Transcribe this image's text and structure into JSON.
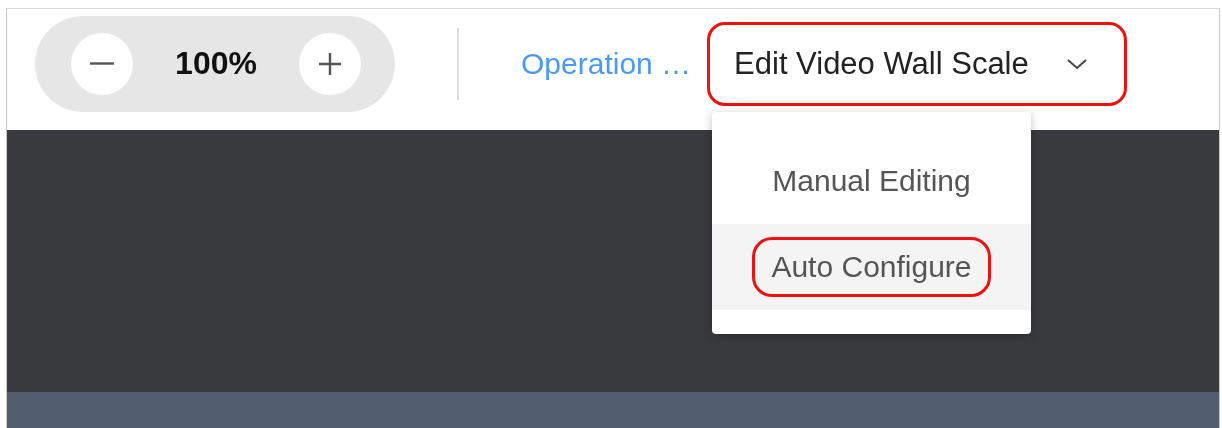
{
  "zoom": {
    "value": "100%"
  },
  "breadcrumb": {
    "label": "Operation …"
  },
  "dropdown": {
    "label": "Edit Video Wall Scale",
    "expanded": true,
    "annotated": true,
    "items": [
      {
        "label": "Manual Editing",
        "selected": false,
        "annotated": false
      },
      {
        "label": "Auto Configure",
        "selected": true,
        "annotated": true
      }
    ]
  }
}
